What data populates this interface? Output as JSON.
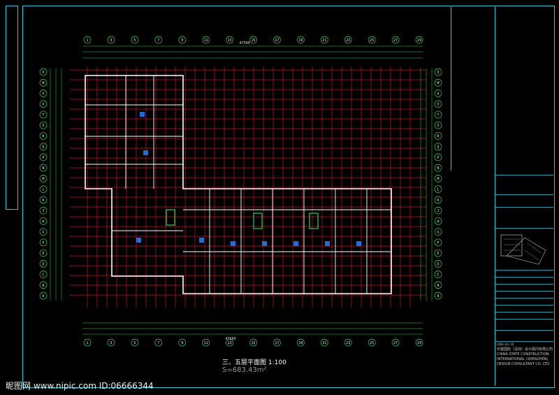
{
  "drawing": {
    "title": "三、五层平面图 1:100",
    "area": "S=683.43m²",
    "overall_width": "47500"
  },
  "axes_top": [
    "1",
    "3",
    "5",
    "7",
    "9",
    "11",
    "13",
    "15",
    "17",
    "19",
    "21",
    "23",
    "25",
    "27",
    "29"
  ],
  "axes_left": [
    "X",
    "W",
    "V",
    "U",
    "T",
    "S",
    "R",
    "Q",
    "P",
    "N",
    "M",
    "L",
    "K",
    "J",
    "H",
    "G",
    "F",
    "E",
    "D",
    "C",
    "B",
    "A"
  ],
  "title_block": {
    "company_lines": [
      "中建国际（深圳）设计顾问有限公司",
      "CHINA STATE CONSTRUCTION",
      "INTERNATIONAL (SHENZHEN)",
      "DESIGN CONSULTANT CO. LTD"
    ],
    "date": "2003.04.18"
  },
  "watermark": "昵图网 www.nipic.com  ID:06666344",
  "colors": {
    "frame": "#33c7d8",
    "grid_red": "#c8102e",
    "wall": "#ffffff",
    "axis_green": "#2fd35a"
  }
}
